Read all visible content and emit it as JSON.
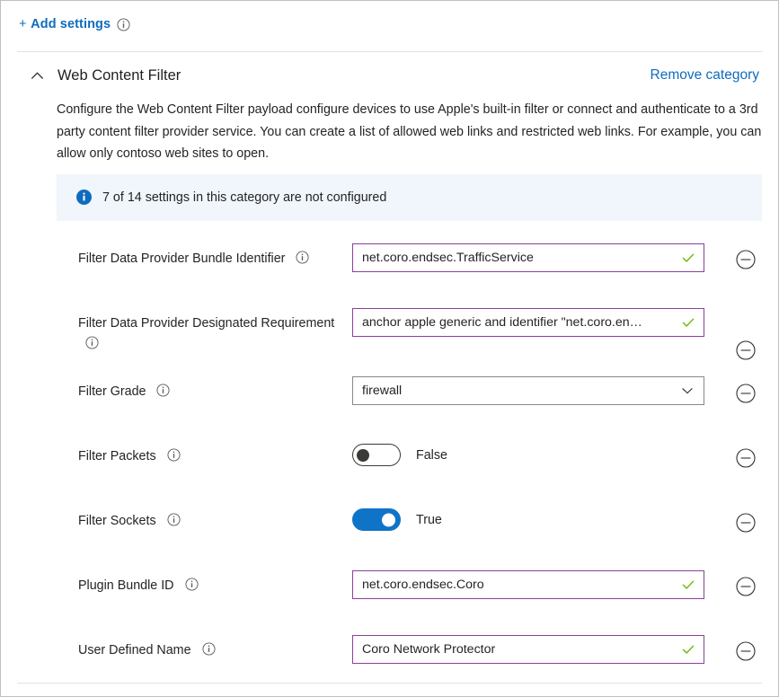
{
  "toolbar": {
    "add_settings_label": "Add settings",
    "add_settings_plus": "+",
    "add_settings_info_icon": "info-icon"
  },
  "category": {
    "title": "Web Content Filter",
    "collapse_icon": "chevron-up-icon",
    "remove_label": "Remove category",
    "description": "Configure the Web Content Filter payload configure devices to use Apple's built-in filter or connect and authenticate to a 3rd party content filter provider service. You can create a list of allowed web links and restricted web links. For example, you can allow only contoso web sites to open.",
    "banner": {
      "icon": "info-filled-icon",
      "text": "7 of 14 settings in this category are not configured"
    }
  },
  "settings": [
    {
      "label": "Filter Data Provider Bundle Identifier",
      "info_icon": "info-icon",
      "control": "text",
      "value": "net.coro.endsec.TrafficService",
      "validation_icon": "check-icon",
      "remove_icon": "minus-circle-icon"
    },
    {
      "label": "Filter Data Provider Designated Requirement",
      "info_icon": "info-icon",
      "control": "text",
      "value": "anchor apple generic and identifier \"net.coro.en…",
      "validation_icon": "check-icon",
      "remove_icon": "minus-circle-icon"
    },
    {
      "label": "Filter Grade",
      "info_icon": "info-icon",
      "control": "dropdown",
      "value": "firewall",
      "caret_icon": "chevron-down-icon",
      "remove_icon": "minus-circle-icon"
    },
    {
      "label": "Filter Packets",
      "info_icon": "info-icon",
      "control": "toggle",
      "value": "False",
      "state": "off",
      "remove_icon": "minus-circle-icon"
    },
    {
      "label": "Filter Sockets",
      "info_icon": "info-icon",
      "control": "toggle",
      "value": "True",
      "state": "on",
      "remove_icon": "minus-circle-icon"
    },
    {
      "label": "Plugin Bundle ID",
      "info_icon": "info-icon",
      "control": "text",
      "value": "net.coro.endsec.Coro",
      "validation_icon": "check-icon",
      "remove_icon": "minus-circle-icon"
    },
    {
      "label": "User Defined Name",
      "info_icon": "info-icon",
      "control": "text",
      "value": "Coro Network Protector",
      "validation_icon": "check-icon",
      "remove_icon": "minus-circle-icon"
    }
  ],
  "colors": {
    "link_blue": "#0f6cbd",
    "toggle_on_blue": "#0f74c8",
    "input_border_purple": "#8c3e9c",
    "validation_green": "#6bb700",
    "banner_bg": "#f0f6fb",
    "text": "#242424"
  }
}
